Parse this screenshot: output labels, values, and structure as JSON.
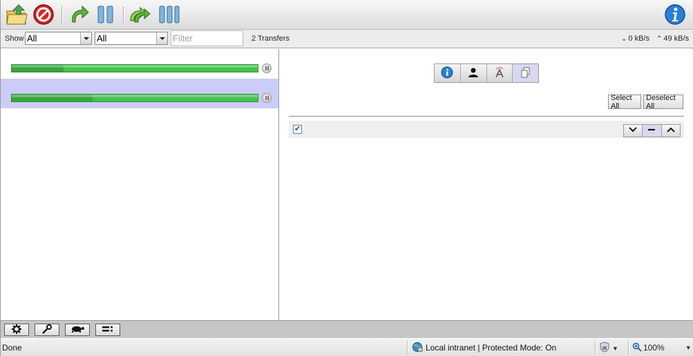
{
  "toolbar": {
    "icons": [
      "open-torrent-icon",
      "remove-icon",
      "start-icon",
      "pause-icon",
      "start-all-icon",
      "pause-all-icon",
      "about-icon"
    ]
  },
  "filter": {
    "show_label": "Show",
    "select1": "All",
    "select2": "All",
    "filter_placeholder": "Filter",
    "transfers_count": "2 Transfers",
    "download_speed": "0 kB/s",
    "upload_speed": "49 kB/s"
  },
  "transfers": [
    {
      "progress": 0.21,
      "selected": false
    },
    {
      "progress": 0.33,
      "selected": true
    }
  ],
  "details": {
    "tabs": [
      "info-tab",
      "peers-tab",
      "trackers-tab",
      "files-tab"
    ],
    "active_tab": "files-tab",
    "select_all": "Select All",
    "deselect_all": "Deselect All",
    "file_checked": true,
    "priority": "normal"
  },
  "bottom_toolbar": {
    "icons": [
      "preferences-icon",
      "tools-icon",
      "turtle-icon",
      "compact-view-icon"
    ]
  },
  "statusbar": {
    "status": "Done",
    "zone": "Local intranet | Protected Mode: On",
    "zoom": "100%"
  },
  "colors": {
    "progress_fill": "#45c24f",
    "progress_done": "#37a43e",
    "selection": "#ccccf7",
    "chrome": "#ececec"
  }
}
